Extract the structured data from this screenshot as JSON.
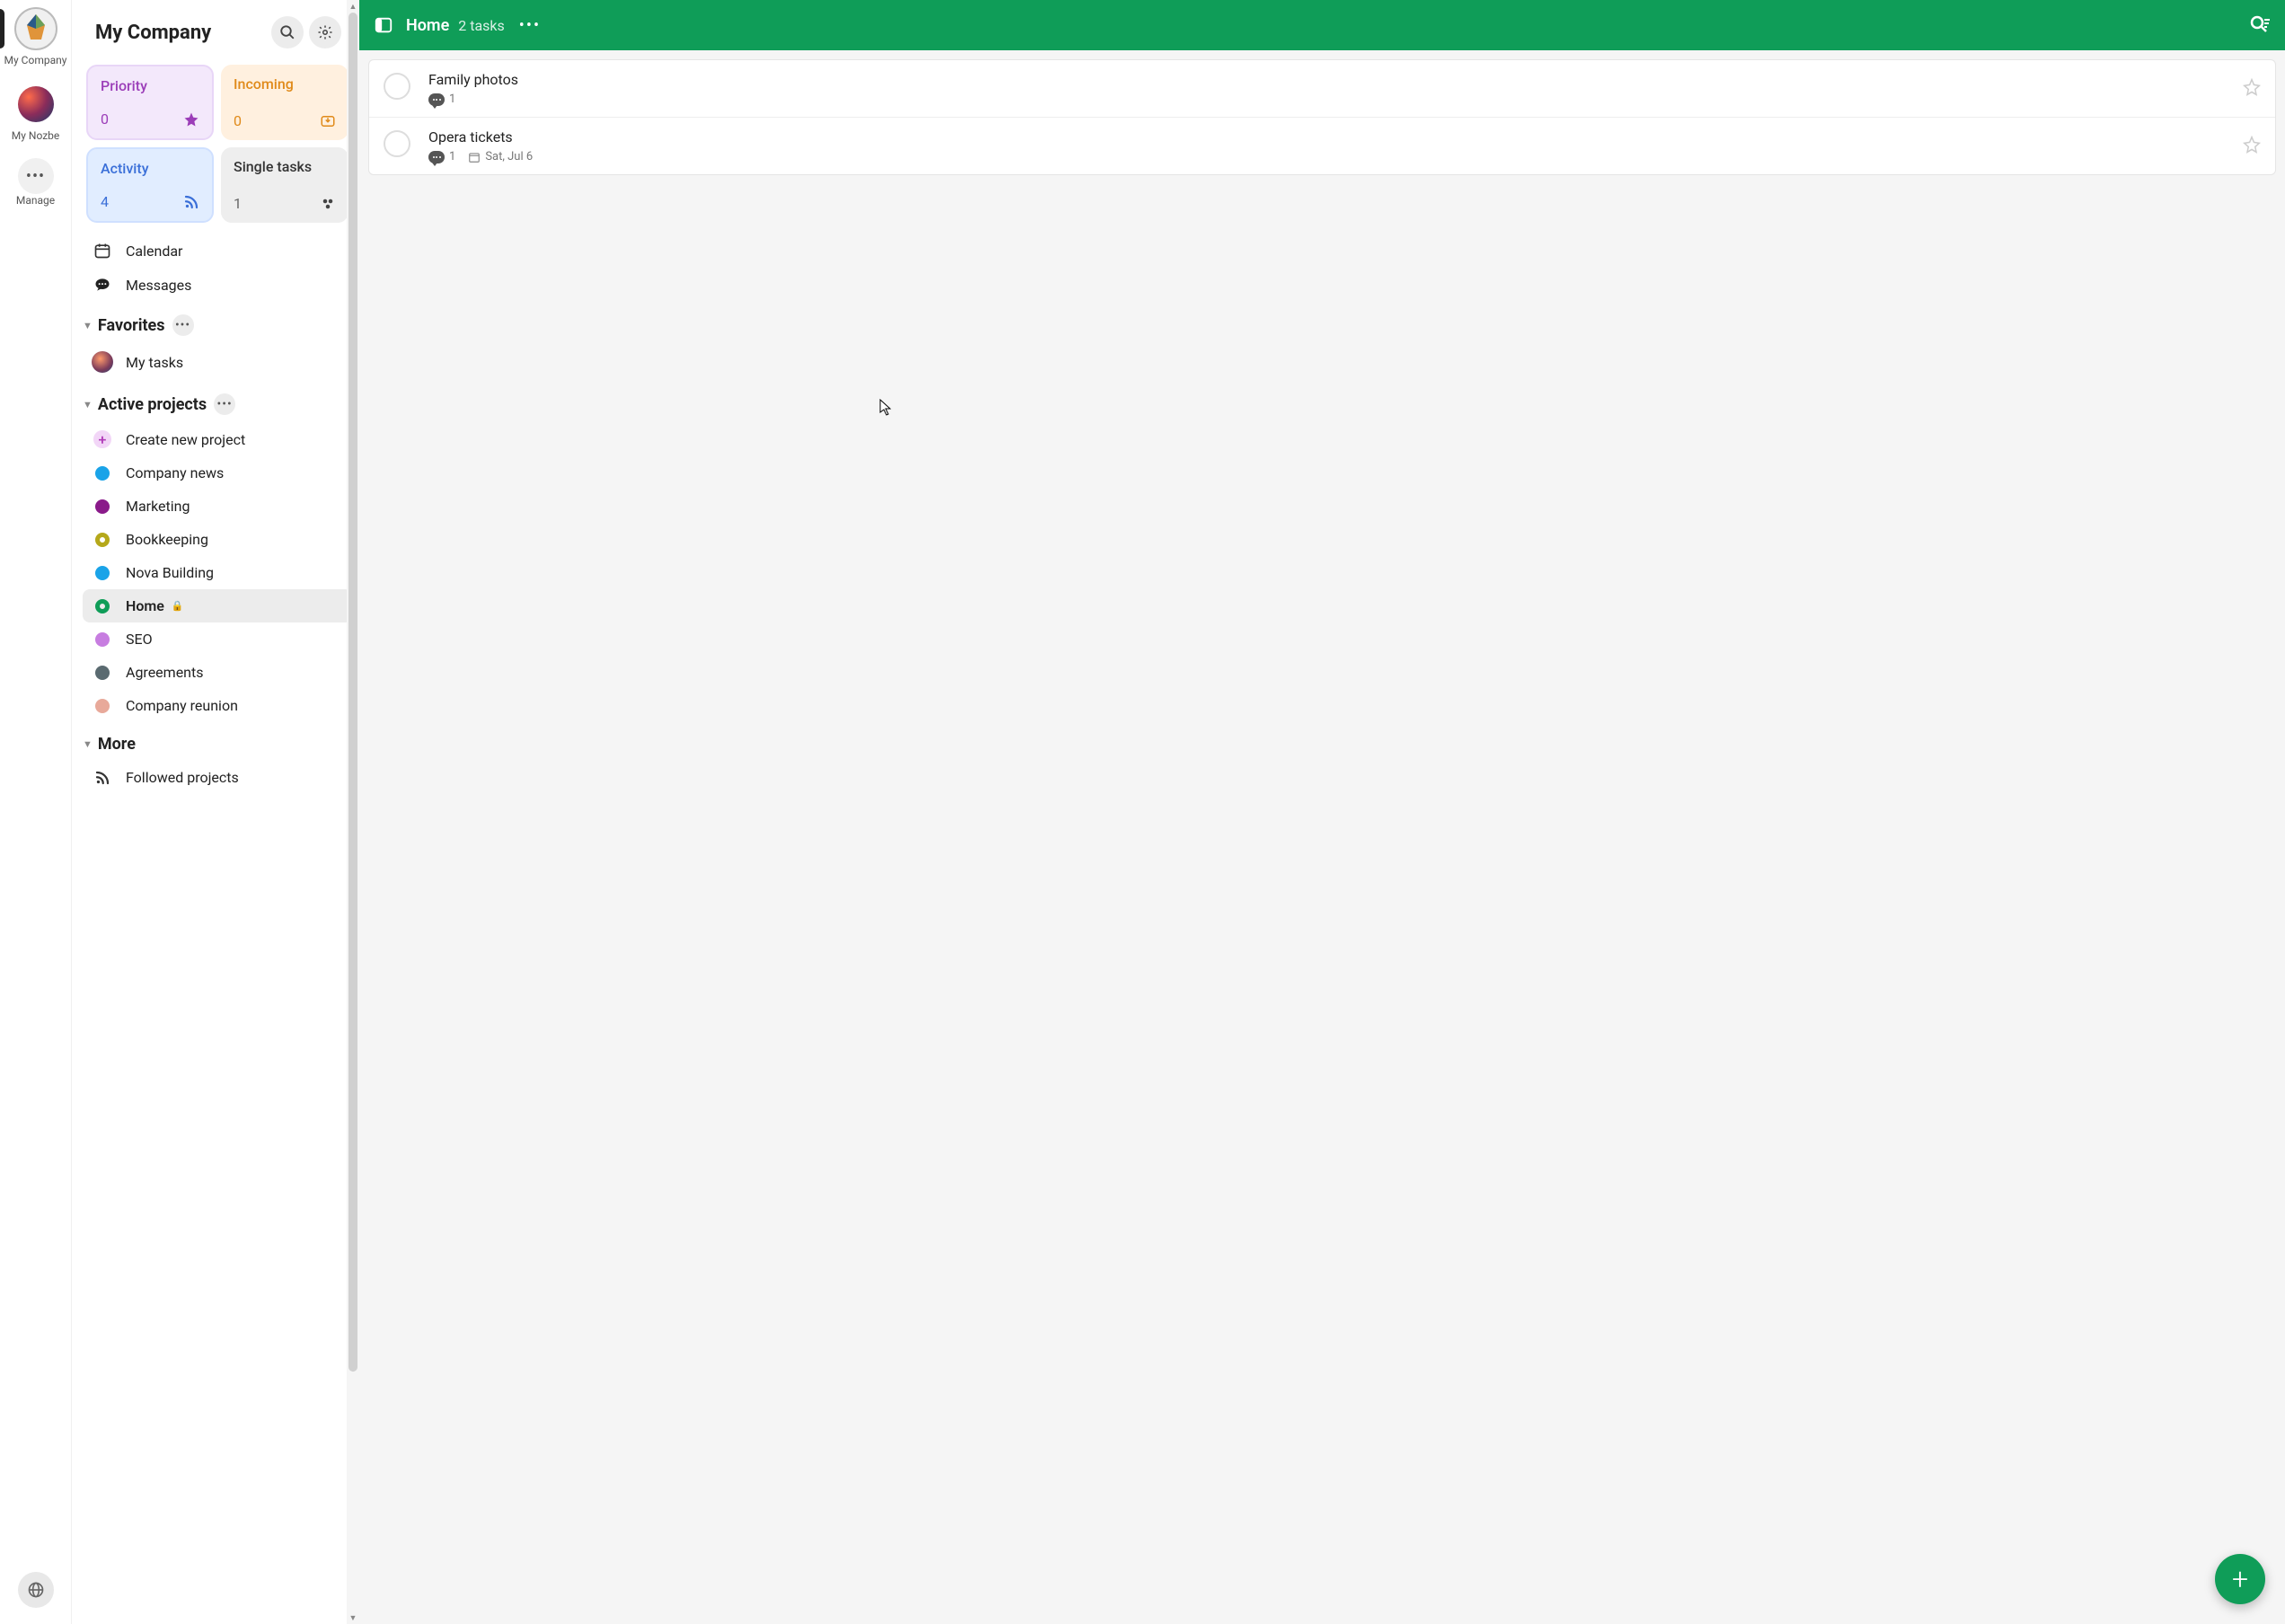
{
  "leftRail": {
    "workspaces": [
      {
        "label": "My Company"
      },
      {
        "label": "My Nozbe"
      }
    ],
    "manage": "Manage"
  },
  "sidebar": {
    "title": "My Company",
    "cards": {
      "priority": {
        "title": "Priority",
        "count": "0"
      },
      "incoming": {
        "title": "Incoming",
        "count": "0"
      },
      "activity": {
        "title": "Activity",
        "count": "4"
      },
      "single": {
        "title": "Single tasks",
        "count": "1"
      }
    },
    "calendar": "Calendar",
    "messages": "Messages",
    "favorites": {
      "title": "Favorites",
      "items": [
        {
          "label": "My tasks"
        }
      ]
    },
    "activeProjects": {
      "title": "Active projects",
      "createLabel": "Create new project",
      "items": [
        {
          "label": "Company news",
          "color": "#1aa3e8"
        },
        {
          "label": "Marketing",
          "color": "#8a1a8a"
        },
        {
          "label": "Bookkeeping",
          "color": "#b5a81a",
          "ring": true
        },
        {
          "label": "Nova Building",
          "color": "#1aa3e8"
        },
        {
          "label": "Home",
          "color": "#0f9d58",
          "ring": true,
          "locked": true,
          "active": true
        },
        {
          "label": "SEO",
          "color": "#c77de0"
        },
        {
          "label": "Agreements",
          "color": "#5a6a70"
        },
        {
          "label": "Company reunion",
          "color": "#e8a99a"
        }
      ]
    },
    "more": {
      "title": "More",
      "followed": "Followed projects"
    }
  },
  "main": {
    "topbar": {
      "title": "Home",
      "subtitle": "2 tasks"
    },
    "tasks": [
      {
        "title": "Family photos",
        "comments": "1",
        "date": ""
      },
      {
        "title": "Opera tickets",
        "comments": "1",
        "date": "Sat, Jul 6"
      }
    ]
  }
}
